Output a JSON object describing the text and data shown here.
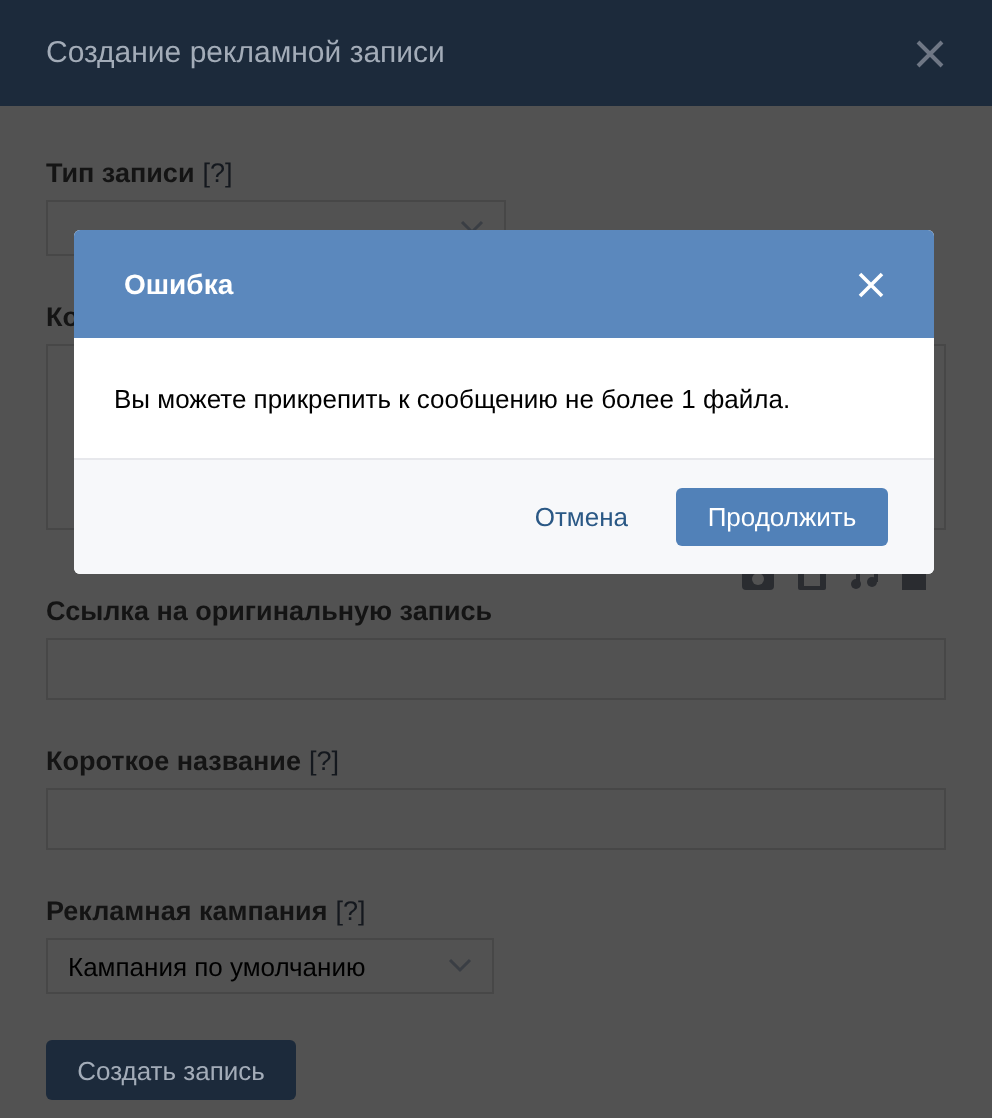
{
  "window": {
    "title": "Создание рекламной записи"
  },
  "fields": [
    {
      "kind": "select",
      "label": "Тип записи",
      "help": "[?]"
    },
    {
      "kind": "textarea",
      "label": "Ко"
    },
    {
      "kind": "input",
      "label": "Ссылка на оригинальную запись"
    },
    {
      "kind": "input",
      "label": "Короткое название",
      "help": "[?]"
    },
    {
      "kind": "select",
      "label": "Рекламная кампания",
      "help": "[?]",
      "value": "Кампания по умолчанию"
    }
  ],
  "submit": "Создать запись",
  "dialog": {
    "title": "Ошибка",
    "message": "Вы можете прикрепить к сообщению не более 1 файла.",
    "buttons": [
      {
        "kind": "link",
        "label": "Отмена"
      },
      {
        "kind": "primary",
        "label": "Продолжить"
      }
    ]
  }
}
